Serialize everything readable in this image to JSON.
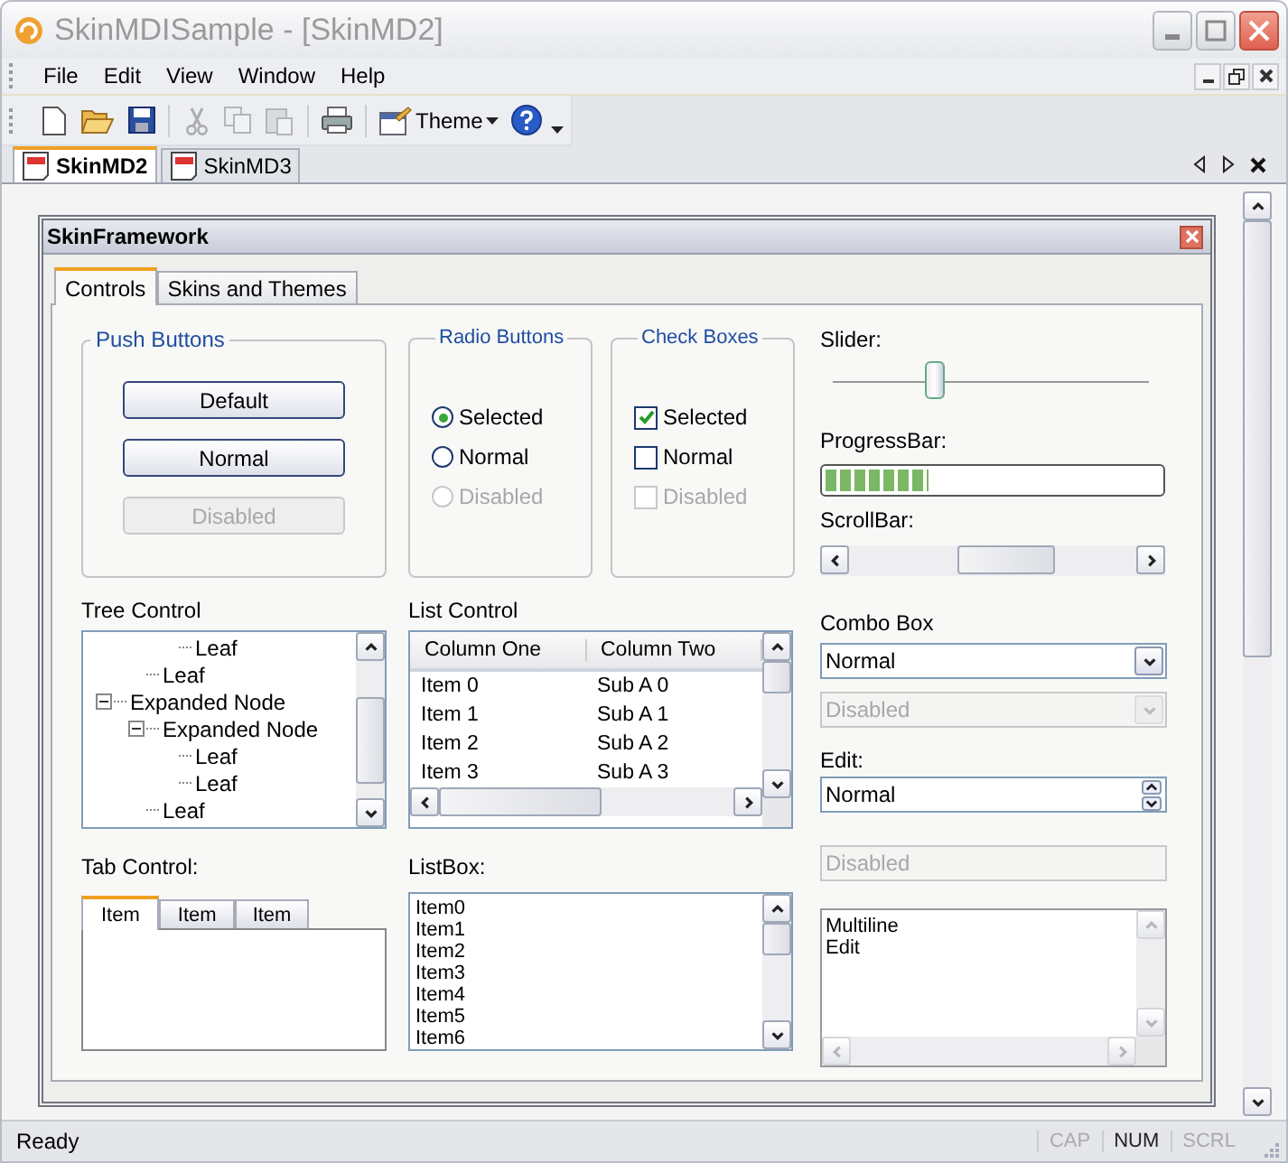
{
  "window": {
    "title": "SkinMDISample - [SkinMD2]"
  },
  "menu": [
    {
      "label": "File"
    },
    {
      "label": "Edit"
    },
    {
      "label": "View"
    },
    {
      "label": "Window"
    },
    {
      "label": "Help"
    }
  ],
  "toolbar": [
    {
      "kind": "new",
      "disabled": false
    },
    {
      "kind": "open",
      "disabled": false
    },
    {
      "kind": "save",
      "disabled": false
    },
    {
      "kind": "separator"
    },
    {
      "kind": "cut",
      "disabled": true
    },
    {
      "kind": "copy",
      "disabled": true
    },
    {
      "kind": "paste",
      "disabled": true
    },
    {
      "kind": "separator"
    },
    {
      "kind": "print",
      "disabled": false
    },
    {
      "kind": "separator"
    },
    {
      "kind": "theme",
      "label": "Theme",
      "disabled": false
    },
    {
      "kind": "help",
      "disabled": false
    }
  ],
  "doc_tabs": [
    {
      "label": "SkinMD2",
      "selected": true
    },
    {
      "label": "SkinMD3",
      "selected": false
    }
  ],
  "child_window": {
    "title": "SkinFramework"
  },
  "tabs": [
    {
      "label": "Controls",
      "selected": true
    },
    {
      "label": "Skins and Themes",
      "selected": false
    }
  ],
  "push_buttons": {
    "title": "Push Buttons",
    "buttons": [
      {
        "label": "Default",
        "disabled": false
      },
      {
        "label": "Normal",
        "disabled": false
      },
      {
        "label": "Disabled",
        "disabled": true
      }
    ]
  },
  "radio_buttons": {
    "title": "Radio Buttons",
    "items": [
      {
        "label": "Selected",
        "selected": true,
        "disabled": false
      },
      {
        "label": "Normal",
        "selected": false,
        "disabled": false
      },
      {
        "label": "Disabled",
        "selected": false,
        "disabled": true
      }
    ]
  },
  "check_boxes": {
    "title": "Check Boxes",
    "items": [
      {
        "label": "Selected",
        "checked": true,
        "disabled": false
      },
      {
        "label": "Normal",
        "checked": false,
        "disabled": false
      },
      {
        "label": "Disabled",
        "checked": false,
        "disabled": true
      }
    ]
  },
  "slider": {
    "label": "Slider:",
    "level": 0.32
  },
  "progress_bar": {
    "label": "ProgressBar:",
    "level": 0.31
  },
  "scroll_bar": {
    "label": "ScrollBar:"
  },
  "tree": {
    "label": "Tree Control",
    "items": [
      {
        "children": [
          {
            "children": [
              {
                "label": "Leaf"
              }
            ]
          },
          {
            "label": "Leaf"
          }
        ]
      },
      {
        "label": "Expanded Node",
        "expanded": true,
        "children": [
          {
            "label": "Expanded Node",
            "expanded": true,
            "children": [
              {
                "label": "Leaf"
              },
              {
                "label": "Leaf"
              }
            ]
          },
          {
            "label": "Leaf"
          }
        ]
      }
    ]
  },
  "list_control": {
    "label": "List Control",
    "columns": [
      "Column One",
      "Column Two"
    ],
    "rows": [
      [
        "Item 0",
        "Sub A 0"
      ],
      [
        "Item 1",
        "Sub A 1"
      ],
      [
        "Item 2",
        "Sub A 2"
      ],
      [
        "Item 3",
        "Sub A 3"
      ]
    ]
  },
  "combo_box": {
    "label": "Combo Box",
    "items": [
      {
        "value": "Normal",
        "disabled": false
      },
      {
        "value": "Disabled",
        "disabled": true
      }
    ]
  },
  "edit": {
    "label": "Edit:",
    "fields": [
      {
        "kind": "spin",
        "value": "Normal",
        "disabled": false
      },
      {
        "kind": "plain",
        "value": "Disabled",
        "disabled": true
      }
    ]
  },
  "tab_control": {
    "label": "Tab Control:",
    "tabs": [
      {
        "label": "Item",
        "selected": true
      },
      {
        "label": "Item",
        "selected": false
      },
      {
        "label": "Item",
        "selected": false
      }
    ]
  },
  "list_box": {
    "label": "ListBox:",
    "items": [
      "Item0",
      "Item1",
      "Item2",
      "Item3",
      "Item4",
      "Item5",
      "Item6"
    ]
  },
  "multiline": {
    "lines": [
      "Multiline",
      "Edit"
    ]
  },
  "status_bar": {
    "text": "Ready",
    "indicators": [
      {
        "label": "CAP",
        "on": false
      },
      {
        "label": "NUM",
        "on": true
      },
      {
        "label": "SCRL",
        "on": false
      }
    ]
  }
}
